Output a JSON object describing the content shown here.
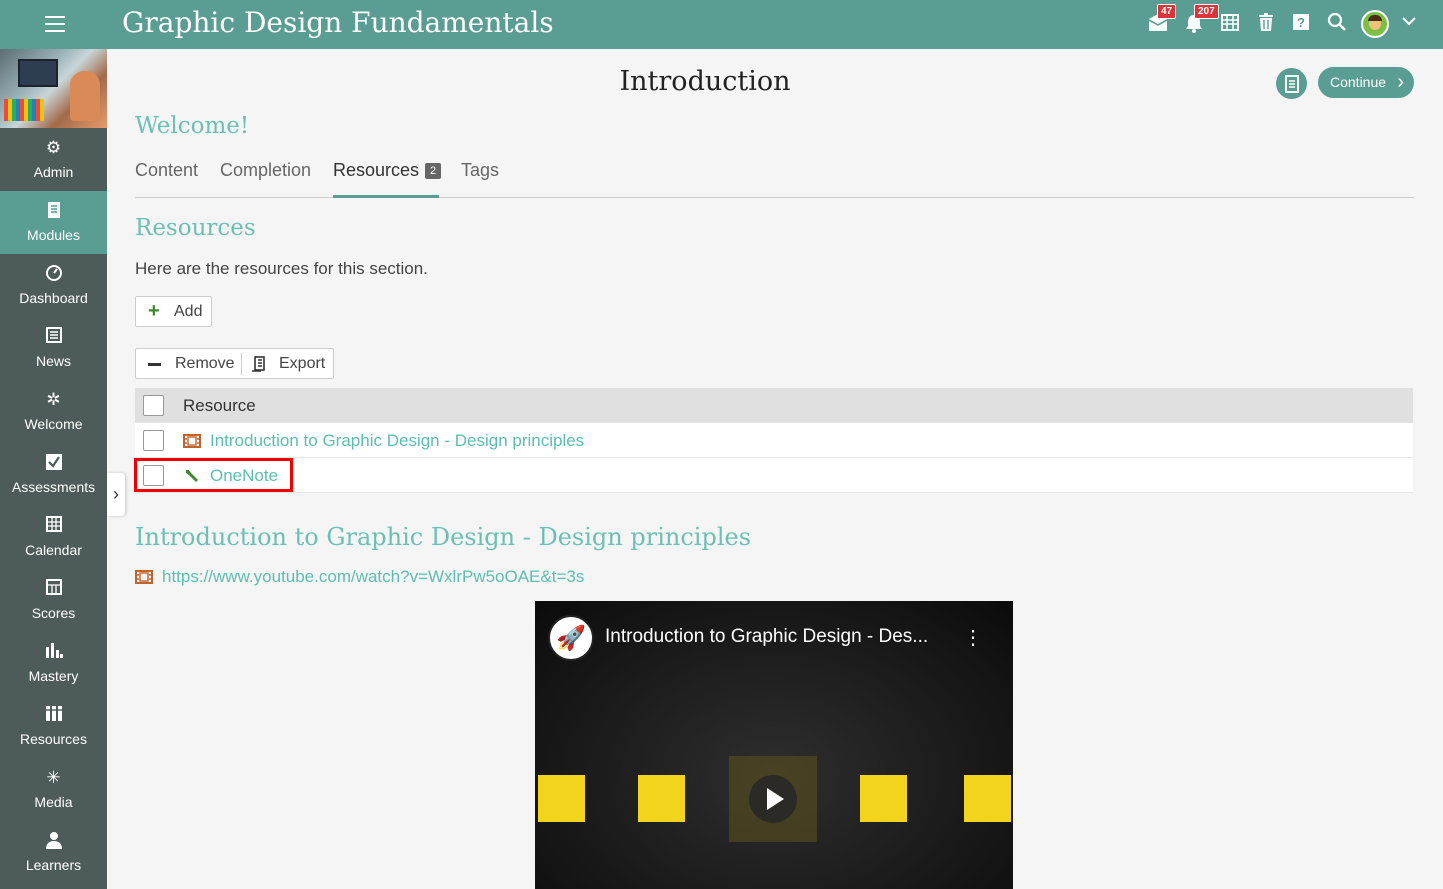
{
  "header": {
    "course_title": "Graphic Design Fundamentals",
    "messages_badge": "47",
    "notifications_badge": "207"
  },
  "sidebar": {
    "items": [
      {
        "label": "Admin",
        "icon": "gear-icon",
        "active": false
      },
      {
        "label": "Modules",
        "icon": "notebook-icon",
        "active": true
      },
      {
        "label": "Dashboard",
        "icon": "gauge-icon",
        "active": false
      },
      {
        "label": "News",
        "icon": "newspaper-icon",
        "active": false
      },
      {
        "label": "Welcome",
        "icon": "sparkle-icon",
        "active": false
      },
      {
        "label": "Assessments",
        "icon": "checkbox-icon",
        "active": false
      },
      {
        "label": "Calendar",
        "icon": "calendar-icon",
        "active": false
      },
      {
        "label": "Scores",
        "icon": "scores-icon",
        "active": false
      },
      {
        "label": "Mastery",
        "icon": "bar-chart-icon",
        "active": false
      },
      {
        "label": "Resources",
        "icon": "books-icon",
        "active": false
      },
      {
        "label": "Media",
        "icon": "media-icon",
        "active": false
      },
      {
        "label": "Learners",
        "icon": "person-icon",
        "active": false
      }
    ]
  },
  "page": {
    "title": "Introduction",
    "continue_label": "Continue",
    "welcome": "Welcome!"
  },
  "tabs": [
    {
      "label": "Content",
      "active": false
    },
    {
      "label": "Completion",
      "active": false
    },
    {
      "label": "Resources",
      "count": "2",
      "active": true
    },
    {
      "label": "Tags",
      "active": false
    }
  ],
  "resources": {
    "heading": "Resources",
    "description": "Here are the resources for this section.",
    "add_label": "Add",
    "remove_label": "Remove",
    "export_label": "Export",
    "column_header": "Resource",
    "rows": [
      {
        "title": "Introduction to Graphic Design - Design principles",
        "icon": "film-icon"
      },
      {
        "title": "OneNote",
        "icon": "wrench-icon"
      }
    ]
  },
  "detail": {
    "title": "Introduction to Graphic Design - Design principles",
    "url": "https://www.youtube.com/watch?v=WxlrPw5oOAE&t=3s",
    "video_title": "Introduction to Graphic Design - Des..."
  },
  "colors": {
    "accent": "#5a9e93",
    "link": "#5bbfb0",
    "sidebar": "#4d5b5a",
    "badge": "#d9353a",
    "highlight": "#e00000"
  }
}
